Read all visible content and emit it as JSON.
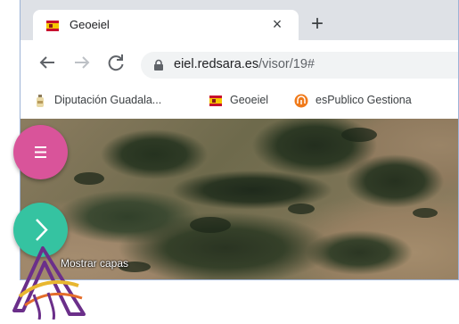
{
  "browser": {
    "tab": {
      "title": "Geoeiel",
      "favicon": "flag-icon",
      "close_glyph": "×"
    },
    "new_tab_glyph": "+",
    "url": {
      "host": "eiel.redsara.es",
      "path": "/visor/19#"
    },
    "bookmarks": [
      {
        "label": "Diputación Guadala...",
        "icon": "bottle-icon"
      },
      {
        "label": "Geoeiel",
        "icon": "flag-icon"
      },
      {
        "label": "esPublico Gestiona",
        "icon": "espublico-icon"
      }
    ]
  },
  "map": {
    "menu_button_color": "#d9549a",
    "layers_button_color": "#35c3a1",
    "layers_label": "Mostrar capas"
  },
  "colors": {
    "logo_purple": "#6b2f8a",
    "logo_yellow": "#e8b730",
    "logo_orange": "#e46d2a"
  }
}
